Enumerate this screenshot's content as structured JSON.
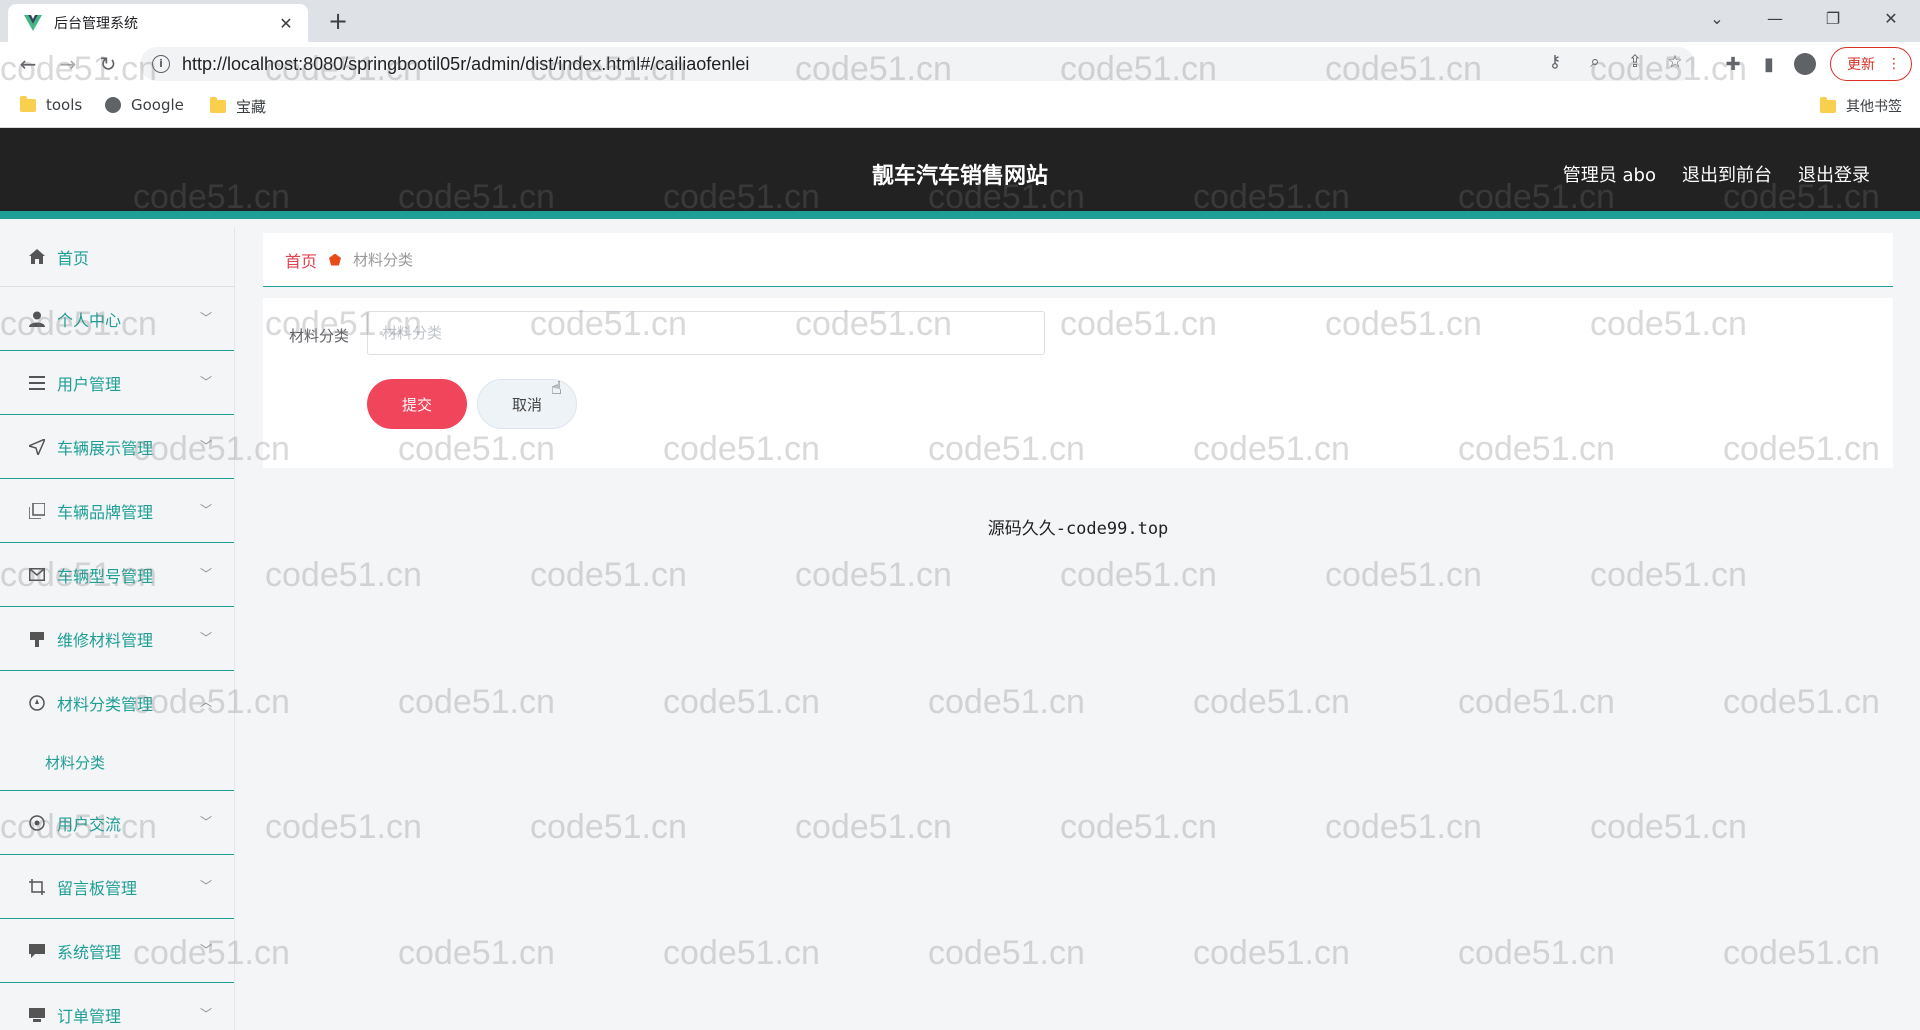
{
  "browser": {
    "tab_title": "后台管理系统",
    "url": "http://localhost:8080/springbootil05r/admin/dist/index.html#/cailiaofenlei",
    "update_label": "更新",
    "bookmarks": [
      {
        "label": "tools",
        "icon": "folder-icon"
      },
      {
        "label": "Google",
        "icon": "globe-icon"
      },
      {
        "label": "宝藏",
        "icon": "folder-icon"
      }
    ],
    "other_bookmarks": "其他书签"
  },
  "header": {
    "title": "靓车汽车销售网站",
    "admin_label": "管理员 abo",
    "back_to_front": "退出到前台",
    "logout": "退出登录"
  },
  "sidebar": {
    "items": [
      {
        "label": "首页",
        "icon": "home-icon"
      },
      {
        "label": "个人中心",
        "icon": "user-icon"
      },
      {
        "label": "用户管理",
        "icon": "list-icon"
      },
      {
        "label": "车辆展示管理",
        "icon": "send-icon"
      },
      {
        "label": "车辆品牌管理",
        "icon": "copy-icon"
      },
      {
        "label": "车辆型号管理",
        "icon": "mail-icon"
      },
      {
        "label": "维修材料管理",
        "icon": "flag-icon"
      },
      {
        "label": "材料分类管理",
        "icon": "compass-icon"
      },
      {
        "label": "用户交流",
        "icon": "chat-icon"
      },
      {
        "label": "留言板管理",
        "icon": "crop-icon"
      },
      {
        "label": "系统管理",
        "icon": "message-icon"
      },
      {
        "label": "订单管理",
        "icon": "order-icon"
      }
    ],
    "sub_item": "材料分类"
  },
  "breadcrumb": {
    "home": "首页",
    "current": "材料分类"
  },
  "form": {
    "label": "材料分类",
    "placeholder": "材料分类",
    "value": "",
    "submit": "提交",
    "cancel": "取消"
  },
  "footer": {
    "text": "源码久久-code99.top"
  },
  "watermark": "code51.cn",
  "colors": {
    "accent": "#1e9f96",
    "header_bg": "#222222",
    "submit": "#f0455a",
    "breadcrumb_home": "#e0414f"
  }
}
